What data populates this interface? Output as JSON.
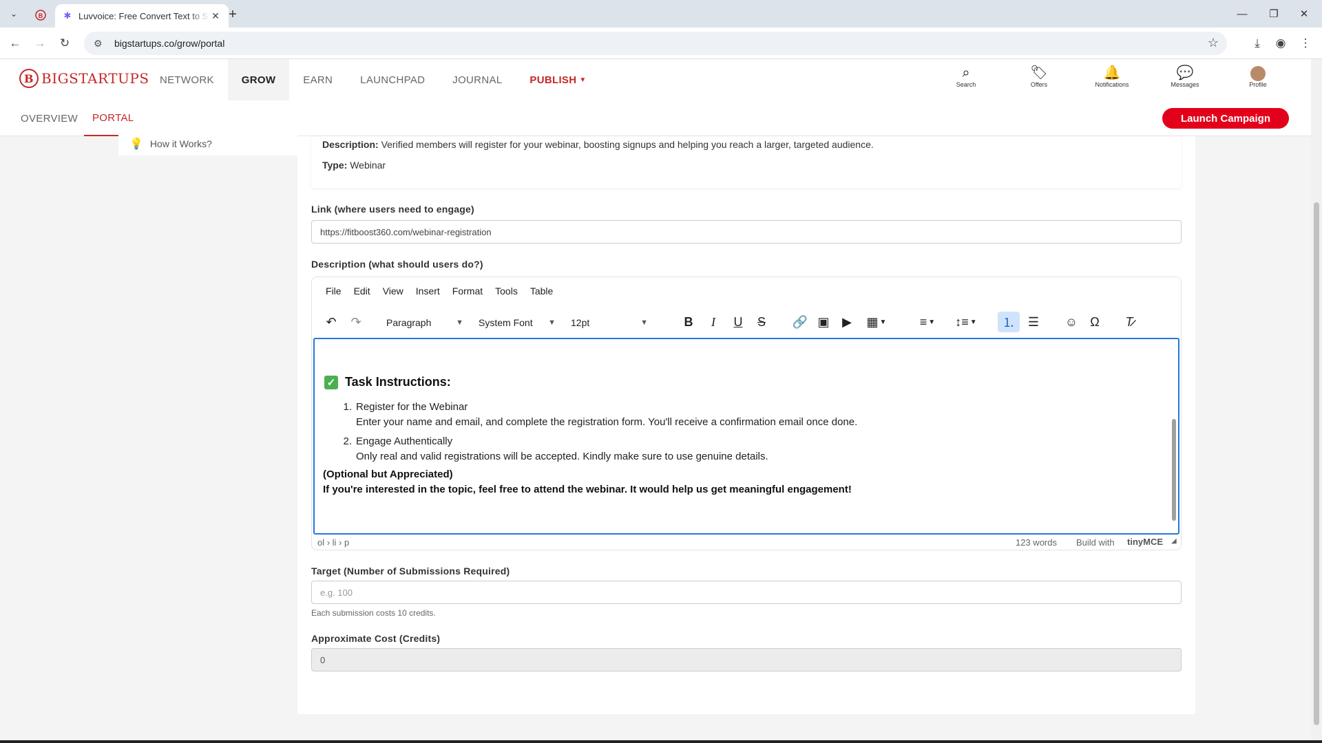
{
  "browser": {
    "tab_title": "Luvvoice: Free Convert Text to S",
    "url": "bigstartups.co/grow/portal"
  },
  "site": {
    "logo_text": "BIGSTARTUPS",
    "logo_letter": "B",
    "nav": [
      "NETWORK",
      "GROW",
      "EARN",
      "LAUNCHPAD",
      "JOURNAL",
      "PUBLISH"
    ],
    "icons": [
      "Search",
      "Offers",
      "Notifications",
      "Messages",
      "Profile"
    ],
    "subnav": [
      "OVERVIEW",
      "PORTAL"
    ],
    "launch_button": "Launch Campaign",
    "side_item": "How it Works?"
  },
  "card": {
    "desc_label": "Description:",
    "desc_text": "Verified members will register for your webinar, boosting signups and helping you reach a larger, targeted audience.",
    "type_label": "Type:",
    "type_text": "Webinar"
  },
  "form": {
    "link_label": "Link (where users need to engage)",
    "link_value": "https://fitboost360.com/webinar-registration",
    "desc_label": "Description (what should users do?)",
    "target_label": "Target (Number of Submissions Required)",
    "target_placeholder": "e.g. 100",
    "target_help": "Each submission costs 10 credits.",
    "cost_label": "Approximate Cost (Credits)",
    "cost_value": "0"
  },
  "editor": {
    "menu": [
      "File",
      "Edit",
      "View",
      "Insert",
      "Format",
      "Tools",
      "Table"
    ],
    "block_format": "Paragraph",
    "font_family": "System Font",
    "font_size": "12pt",
    "heading": "Task Instructions:",
    "items": [
      {
        "num": "1.",
        "title": "Register for the Webinar",
        "detail": "Enter your name and email, and complete the registration form. You'll receive a confirmation email once done."
      },
      {
        "num": "2.",
        "title": "Engage Authentically",
        "detail": "Only real and valid registrations will be accepted. Kindly make sure to use genuine details."
      }
    ],
    "optional_title": "(Optional but Appreciated)",
    "optional_text": "If you're interested in the topic, feel free to attend the webinar. It would help us get meaningful engagement!",
    "path": "ol › li › p",
    "word_count": "123 words",
    "build_with": "Build with",
    "brand": "tinyMCE"
  }
}
